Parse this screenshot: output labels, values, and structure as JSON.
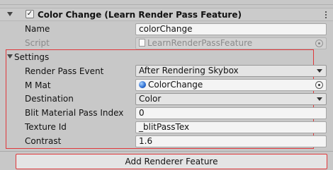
{
  "header": {
    "title": "Color Change (Learn Render Pass Feature)",
    "enabled_checked": true
  },
  "fields": {
    "name_label": "Name",
    "name_value": "colorChange",
    "script_label": "Script",
    "script_value": "LearnRenderPassFeature"
  },
  "settings": {
    "label": "Settings",
    "render_pass_event_label": "Render Pass Event",
    "render_pass_event_value": "After Rendering Skybox",
    "m_mat_label": "M Mat",
    "m_mat_value": "ColorChange",
    "destination_label": "Destination",
    "destination_value": "Color",
    "blit_pass_index_label": "Blit Material Pass Index",
    "blit_pass_index_value": "0",
    "texture_id_label": "Texture Id",
    "texture_id_value": "_blitPassTex",
    "contrast_label": "Contrast",
    "contrast_value": "1.6"
  },
  "footer": {
    "add_renderer_feature_label": "Add Renderer Feature"
  },
  "colors": {
    "highlight_border": "#e0383b",
    "panel_bg": "#c8c8c8"
  }
}
